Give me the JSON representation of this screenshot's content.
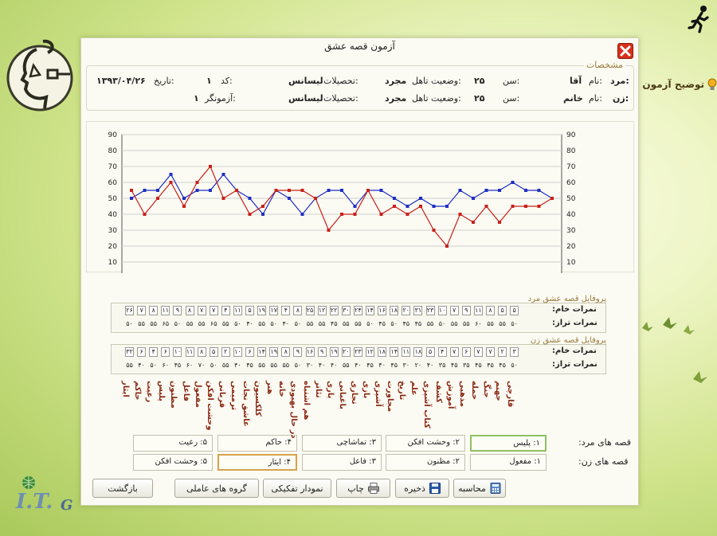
{
  "dialog": {
    "title": "آزمون قصه عشق"
  },
  "side_link": {
    "label": "توضیح آزمون"
  },
  "spec": {
    "legend": "مشخصات",
    "man": {
      "prefix": "مرد:",
      "name_label": "نام:",
      "name": "آقا",
      "age_label": "سن:",
      "age": "۲۵",
      "marital_label": "وضعیت تاهل:",
      "marital": "مجرد",
      "edu_label": "تحصیلات:",
      "edu": "لیسانس"
    },
    "woman": {
      "prefix": "زن:",
      "name_label": "نام:",
      "name": "خانم",
      "age_label": "سن:",
      "age": "۲۵",
      "marital_label": "وضعیت تاهل:",
      "marital": "مجرد",
      "edu_label": "تحصیلات:",
      "edu": "لیسانس"
    },
    "code_label": "کد:",
    "code": "۱",
    "date_label": "تاریخ:",
    "date": "۱۳۹۳/۰۴/۲۶",
    "examiner_label": "آزمونگر:",
    "examiner": "۱"
  },
  "chart_data": {
    "type": "line",
    "ylim": [
      0,
      90
    ],
    "yticks": [
      10,
      20,
      30,
      40,
      50,
      60,
      70,
      80,
      90
    ],
    "grid": true,
    "colors": [
      "#1f2fc4",
      "#c8201a"
    ],
    "series": [
      {
        "values": [
          50,
          55,
          55,
          65,
          50,
          55,
          55,
          65,
          55,
          50,
          40,
          55,
          50,
          40,
          50,
          55,
          55,
          45,
          55,
          55,
          50,
          45,
          50,
          45,
          45,
          55,
          50,
          55,
          55,
          60,
          55,
          55,
          50
        ]
      },
      {
        "values": [
          55,
          40,
          50,
          60,
          45,
          60,
          70,
          50,
          55,
          40,
          45,
          55,
          55,
          55,
          50,
          30,
          40,
          40,
          55,
          40,
          45,
          40,
          45,
          30,
          20,
          40,
          35,
          45,
          35,
          45,
          45,
          45,
          50
        ]
      }
    ]
  },
  "profiles": {
    "raw_label": "نمرات خام:",
    "std_label": "نمرات تراز:",
    "man": {
      "title": "پروفایل قصه عشق مرد",
      "raw": [
        "۲۶",
        "۷",
        "۸",
        "۱۱",
        "۹",
        "۸",
        "۷",
        "۷",
        "۴",
        "۱۱",
        "۵",
        "۱۹",
        "۱۷",
        "۴",
        "۸",
        "۲۵",
        "۱۲",
        "۲۲",
        "۳۰",
        "۲۴",
        "۱۴",
        "۱۶",
        "۱۸",
        "۲۰",
        "۳۱",
        "۲۳",
        "۱۰",
        "۷",
        "۹",
        "۱۱",
        "۸",
        "۵",
        "۵"
      ],
      "std": [
        "۵۰",
        "۵۵",
        "۵۵",
        "۶۵",
        "۵۰",
        "۵۵",
        "۵۵",
        "۶۵",
        "۵۵",
        "۵۰",
        "۴۰",
        "۵۵",
        "۵۰",
        "۴۰",
        "۵۰",
        "۵۵",
        "۵۵",
        "۴۵",
        "۵۵",
        "۵۵",
        "۵۰",
        "۴۵",
        "۵۰",
        "۴۵",
        "۴۵",
        "۵۵",
        "۵۰",
        "۵۵",
        "۵۵",
        "۶۰",
        "۵۵",
        "۵۵",
        "۵۰"
      ]
    },
    "woman": {
      "title": "پروفایل قصه عشق زن",
      "raw": [
        "۳۲",
        "۶",
        "۴",
        "۶",
        "۱۰",
        "۱۱",
        "۸",
        "۵",
        "۲",
        "۱۰",
        "۶",
        "۱۴",
        "۱۹",
        "۸",
        "۹",
        "۱۶",
        "۹",
        "۱۹",
        "۲۰",
        "۲۳",
        "۱۲",
        "۱۸",
        "۱۴",
        "۱۱",
        "۱۸",
        "۵",
        "۴",
        "۷",
        "۶",
        "۷",
        "۷",
        "۲",
        "۳"
      ],
      "std": [
        "۵۵",
        "۴۰",
        "۵۰",
        "۶۰",
        "۴۵",
        "۶۰",
        "۷۰",
        "۵۰",
        "۵۵",
        "۴۰",
        "۴۵",
        "۵۵",
        "۵۵",
        "۵۵",
        "۵۰",
        "۳۰",
        "۴۰",
        "۴۰",
        "۵۵",
        "۴۰",
        "۴۵",
        "۴۰",
        "۴۵",
        "۳۰",
        "۲۰",
        "۴۰",
        "۳۵",
        "۴۵",
        "۳۵",
        "۴۵",
        "۴۵",
        "۴۵",
        "۵۰"
      ]
    }
  },
  "scales": [
    "ایثار",
    "حاکم",
    "رعیت",
    "پلیس",
    "مظنون",
    "فاعل",
    "مفعول",
    "وحشت افکن",
    "قربانی",
    "ترمیمی",
    "عاشق نجات",
    "کلکسیون",
    "هنر",
    "خانه",
    "در حال بهبودی",
    "هم اشتباه",
    "تئاتر",
    "یاری",
    "باغبانی",
    "تجاری",
    "بازی",
    "آشپزی",
    "مجاورت",
    "تاریخ",
    "علم",
    "کتاب آشپزی",
    "کشف",
    "آموزش",
    "مذهبی",
    "حمله",
    "جنگ",
    "جهنم",
    "قارچی"
  ],
  "stories": {
    "man_label": "قصه های مرد:",
    "woman_label": "قصه های زن:",
    "man": [
      "۱: پلیس",
      "۲: وحشت افکن",
      "۳: تماشاچی",
      "۴: حاکم",
      "۵: رعیت"
    ],
    "woman": [
      "۱: مفعول",
      "۲: مظنون",
      "۳: فاعل",
      "۴: ایثار",
      "۵: وحشت افکن"
    ]
  },
  "buttons": {
    "calc": "محاسبه",
    "save": "ذخیره",
    "print": "چاپ",
    "compare": "نمودار تفکیکی",
    "groups": "گروه های عاملی",
    "back": "بازگشت"
  }
}
